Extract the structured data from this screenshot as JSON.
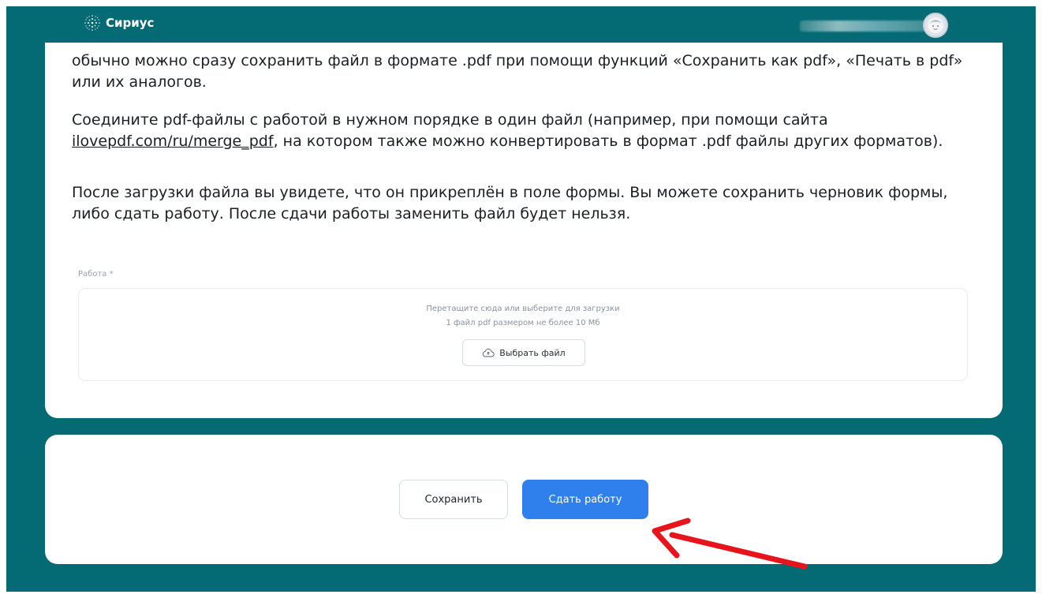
{
  "header": {
    "logo_text": "Сириус",
    "logo_icon": "sirius-star-icon",
    "avatar_icon": "user-avatar-icon"
  },
  "content": {
    "paragraph_1": "обычно можно сразу сохранить файл в формате .pdf при помощи функций «Сохранить как pdf», «Печать в pdf» или их аналогов.",
    "paragraph_2_before": "Соедините pdf-файлы с работой в нужном порядке в один файл (например, при помощи сайта ",
    "paragraph_2_link": "ilovepdf.com/ru/merge_pdf",
    "paragraph_2_after": ", на котором также можно конвертировать в формат .pdf файлы других форматов).",
    "paragraph_3": "После загрузки файла вы увидете, что он прикреплён в поле формы. Вы можете сохранить черновик формы, либо сдать работу. После сдачи работы заменить файл будет нельзя."
  },
  "upload": {
    "label": "Работа *",
    "hint_line_1": "Перетащите сюда или выберите для загрузки",
    "hint_line_2": "1 файл pdf размером не более 10 Мб",
    "button_label": "Выбрать файл",
    "button_icon": "cloud-upload-icon"
  },
  "actions": {
    "save_label": "Сохранить",
    "submit_label": "Сдать работу"
  },
  "colors": {
    "background": "#046a73",
    "accent": "#2f80ed",
    "annotation_arrow": "#e8141c"
  }
}
